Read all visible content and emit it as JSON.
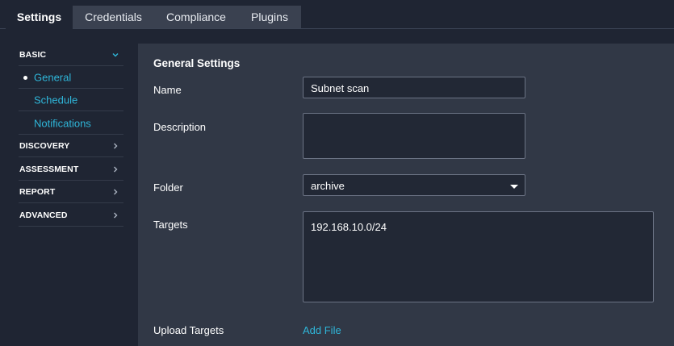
{
  "tabs": [
    {
      "label": "Settings",
      "active": true
    },
    {
      "label": "Credentials",
      "active": false
    },
    {
      "label": "Compliance",
      "active": false
    },
    {
      "label": "Plugins",
      "active": false
    }
  ],
  "sidebar": {
    "basic": {
      "label": "BASIC",
      "expanded": true,
      "icon": "chevron-down-icon"
    },
    "items": [
      {
        "label": "General",
        "selected": true
      },
      {
        "label": "Schedule",
        "selected": false
      },
      {
        "label": "Notifications",
        "selected": false
      }
    ],
    "sections": [
      {
        "label": "DISCOVERY",
        "icon": "chevron-right-icon"
      },
      {
        "label": "ASSESSMENT",
        "icon": "chevron-right-icon"
      },
      {
        "label": "REPORT",
        "icon": "chevron-right-icon"
      },
      {
        "label": "ADVANCED",
        "icon": "chevron-right-icon"
      }
    ]
  },
  "main": {
    "heading": "General Settings",
    "name": {
      "label": "Name",
      "value": "Subnet scan"
    },
    "description": {
      "label": "Description",
      "value": ""
    },
    "folder": {
      "label": "Folder",
      "value": "archive"
    },
    "targets": {
      "label": "Targets",
      "value": "192.168.10.0/24"
    },
    "upload": {
      "label": "Upload Targets",
      "link": "Add File"
    }
  },
  "colors": {
    "accent": "#2fb6d9",
    "background": "#1f2533",
    "panel": "#313846"
  }
}
